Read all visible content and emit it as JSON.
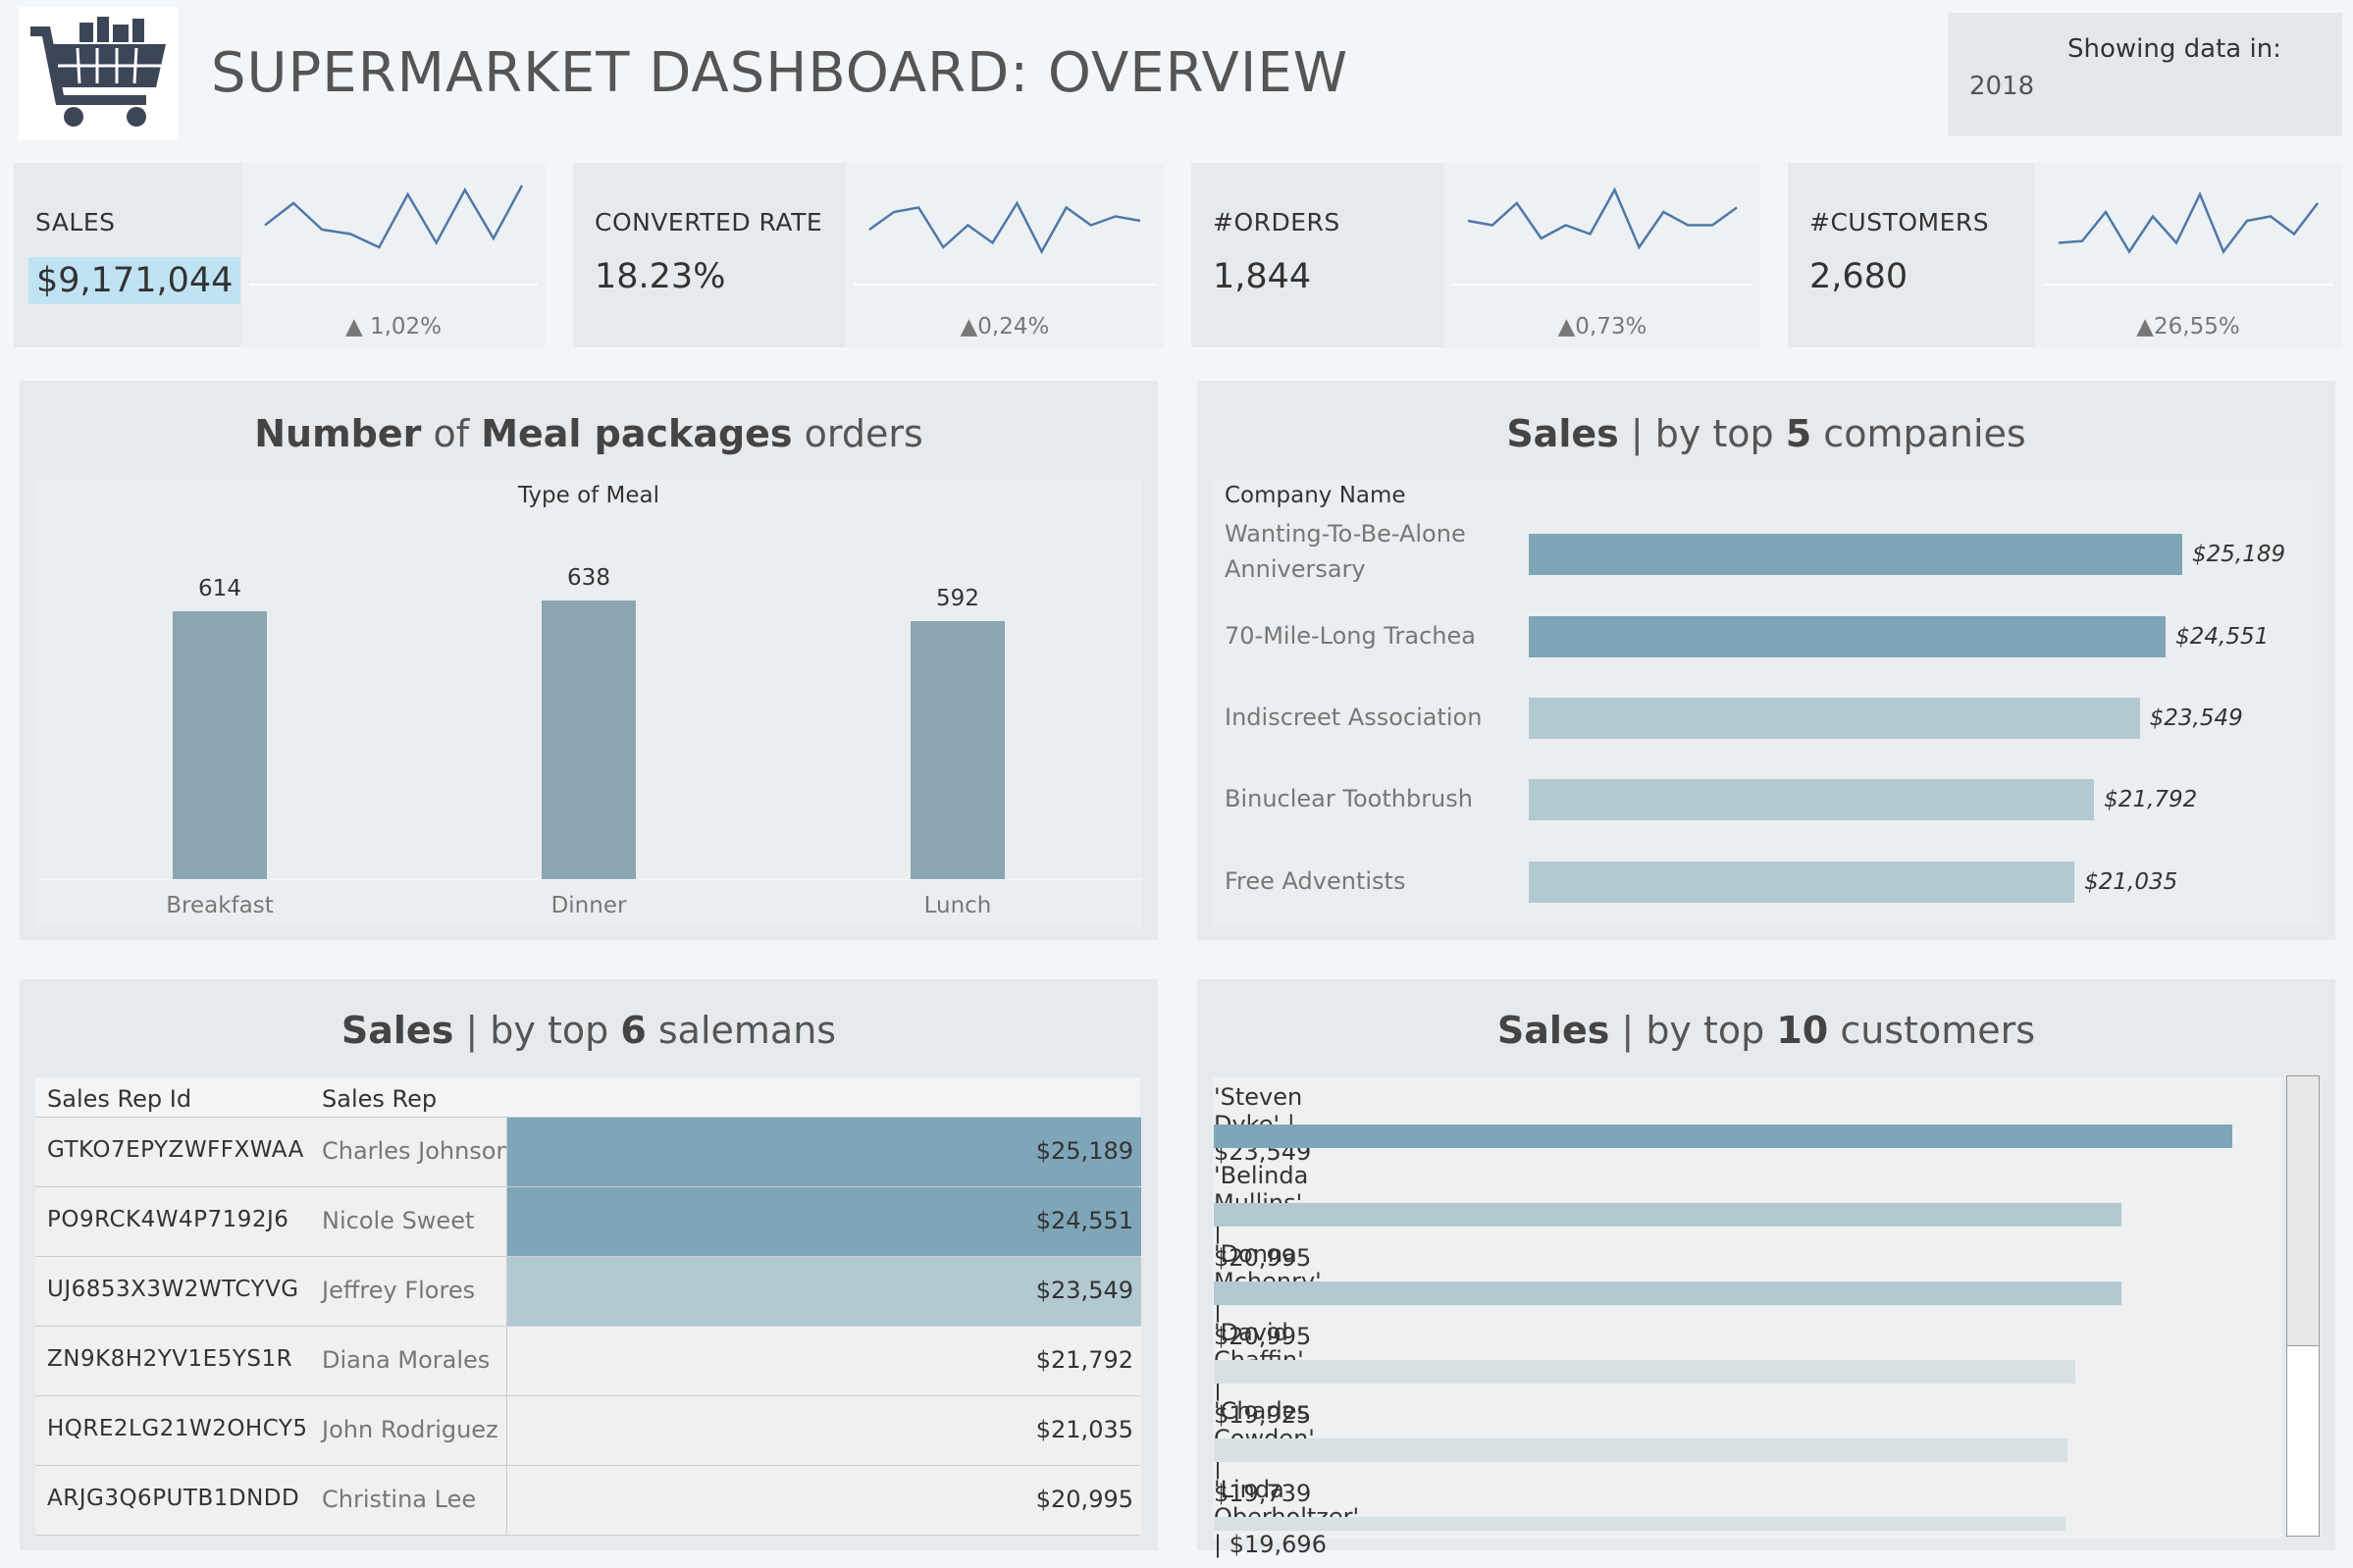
{
  "header": {
    "title": "SUPERMARKET DASHBOARD: OVERVIEW",
    "logo_icon": "shopping-cart-icon",
    "filter_label": "Showing data in:",
    "filter_value": "2018"
  },
  "kpis": [
    {
      "name": "SALES",
      "value": "$9,171,044",
      "delta": "▲ 1,02%",
      "spark": [
        55,
        30,
        60,
        65,
        80,
        20,
        75,
        15,
        70,
        10
      ]
    },
    {
      "name": "CONVERTED RATE",
      "value": "18.23%",
      "delta": "▲0,24%",
      "spark": [
        60,
        40,
        35,
        80,
        55,
        75,
        30,
        85,
        35,
        55,
        45,
        50
      ]
    },
    {
      "name": "#ORDERS",
      "value": "1,844",
      "delta": "▲0,73%",
      "spark": [
        50,
        55,
        30,
        70,
        55,
        65,
        15,
        80,
        40,
        55,
        55,
        35
      ]
    },
    {
      "name": "#CUSTOMERS",
      "value": "2,680",
      "delta": "▲26,55%",
      "spark": [
        75,
        73,
        40,
        85,
        45,
        75,
        20,
        85,
        50,
        45,
        65,
        30
      ]
    }
  ],
  "meal_panel": {
    "title_parts": [
      "Number",
      " of ",
      "Meal packages",
      " orders"
    ],
    "axis_title": "Type of Meal"
  },
  "companies_panel": {
    "title_bold": "Sales",
    "title_sep": " | ",
    "title_light1": "by top ",
    "title_bold2": "5",
    "title_light2": " companies",
    "column_header": "Company Name"
  },
  "salesmen_panel": {
    "title_bold": "Sales",
    "title_sep": " | ",
    "title_light1": "by top ",
    "title_bold2": "6",
    "title_light2": " salemans",
    "col_id": "Sales Rep Id",
    "col_rep": "Sales Rep",
    "rows": [
      {
        "id": "GTKO7EPYZWFFXWAA",
        "rep": "Charles Johnson",
        "amount": "$25,189"
      },
      {
        "id": "PO9RCK4W4P7192J6",
        "rep": "Nicole Sweet",
        "amount": "$24,551"
      },
      {
        "id": "UJ6853X3W2WTCYVG",
        "rep": "Jeffrey Flores",
        "amount": "$23,549"
      },
      {
        "id": "ZN9K8H2YV1E5YS1R",
        "rep": "Diana Morales",
        "amount": "$21,792"
      },
      {
        "id": "HQRE2LG21W2OHCY5",
        "rep": "John Rodriguez",
        "amount": "$21,035"
      },
      {
        "id": "ARJG3Q6PUTB1DNDD",
        "rep": "Christina Lee",
        "amount": "$20,995"
      }
    ]
  },
  "customers_panel": {
    "title_bold": "Sales",
    "title_sep": " | ",
    "title_light1": "by top ",
    "title_bold2": "10",
    "title_light2": " customers",
    "rows": [
      {
        "label": "'Steven Dyke' | $23,549"
      },
      {
        "label": "'Belinda Mullins' | $20,995"
      },
      {
        "label": "'Donna Mchenry' | $20,995"
      },
      {
        "label": "'David Chaffin' | $19,925"
      },
      {
        "label": "'Charles Cowden' | $19,739"
      },
      {
        "label": "'Linda Oberholtzer' | $19,696"
      }
    ]
  },
  "colors": {
    "bar_dark": "#7fa6b8",
    "bar_light": "#b3c9d2",
    "meal_bar": "#8aa6b1",
    "spark": "#4e79a7",
    "cust_bar_1": "#7fa6b8",
    "cust_bar_mid": "#b3c9d2",
    "cust_bar_low": "#d9e0e3"
  },
  "chart_data": [
    {
      "type": "bar",
      "title": "Number of Meal packages orders",
      "xlabel": "Type of Meal",
      "categories": [
        "Breakfast",
        "Dinner",
        "Lunch"
      ],
      "values": [
        614,
        638,
        592
      ],
      "ylim": [
        0,
        700
      ]
    },
    {
      "type": "bar",
      "title": "Sales | by top 5 companies",
      "xlabel": "Company Name",
      "categories": [
        "Wanting-To-Be-Alone Anniversary",
        "70-Mile-Long Trachea",
        "Indiscreet Association",
        "Binuclear Toothbrush",
        "Free Adventists"
      ],
      "values": [
        25189,
        24551,
        23549,
        21792,
        21035
      ],
      "value_labels": [
        "$25,189",
        "$24,551",
        "$23,549",
        "$21,792",
        "$21,035"
      ]
    },
    {
      "type": "bar",
      "title": "Sales | by top 10 customers",
      "categories": [
        "Steven Dyke",
        "Belinda Mullins",
        "Donna Mchenry",
        "David Chaffin",
        "Charles Cowden",
        "Linda Oberholtzer"
      ],
      "values": [
        23549,
        20995,
        20995,
        19925,
        19739,
        19696
      ]
    }
  ]
}
